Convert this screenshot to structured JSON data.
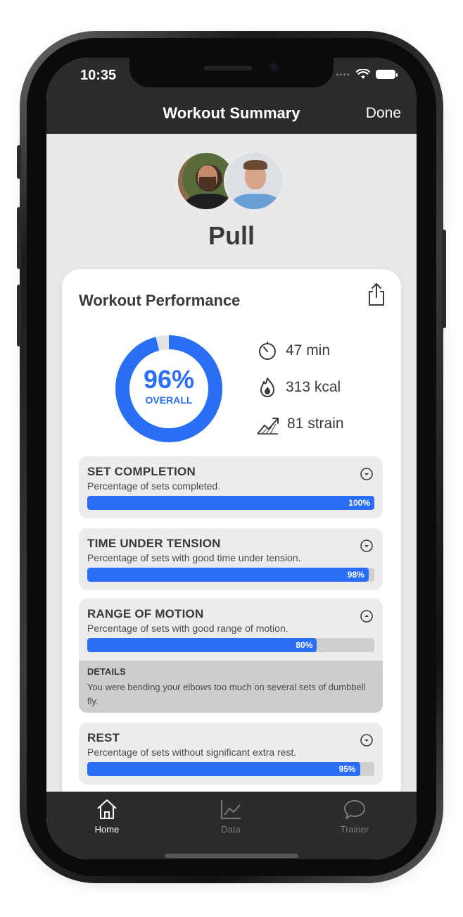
{
  "status": {
    "time": "10:35"
  },
  "nav": {
    "title": "Workout Summary",
    "done_label": "Done"
  },
  "workout": {
    "name": "Pull"
  },
  "performance": {
    "title": "Workout Performance",
    "overall_percent": 96,
    "overall_text": "96%",
    "overall_label": "OVERALL",
    "stats": {
      "duration": "47 min",
      "calories": "313 kcal",
      "strain": "81 strain"
    }
  },
  "metrics": [
    {
      "title": "SET COMPLETION",
      "description": "Percentage of sets completed.",
      "percent": 100,
      "percent_label": "100%",
      "expanded": false
    },
    {
      "title": "TIME UNDER TENSION",
      "description": "Percentage of sets with good time under tension.",
      "percent": 98,
      "percent_label": "98%",
      "expanded": false
    },
    {
      "title": "RANGE OF MOTION",
      "description": "Percentage of sets with good range of motion.",
      "percent": 80,
      "percent_label": "80%",
      "expanded": true,
      "details_title": "DETAILS",
      "details_text": "You were bending your elbows too much on several sets of dumbbell fly."
    },
    {
      "title": "REST",
      "description": "Percentage of sets without significant extra rest.",
      "percent": 95,
      "percent_label": "95%",
      "expanded": false
    }
  ],
  "tabs": [
    {
      "label": "Home",
      "icon": "home-icon",
      "active": true
    },
    {
      "label": "Data",
      "icon": "chart-icon",
      "active": false
    },
    {
      "label": "Trainer",
      "icon": "chat-bubble-icon",
      "active": false
    }
  ],
  "colors": {
    "accent": "#2a6ef5",
    "bar_bg": "#2b2b2e",
    "page_bg": "#e9e9e9"
  }
}
